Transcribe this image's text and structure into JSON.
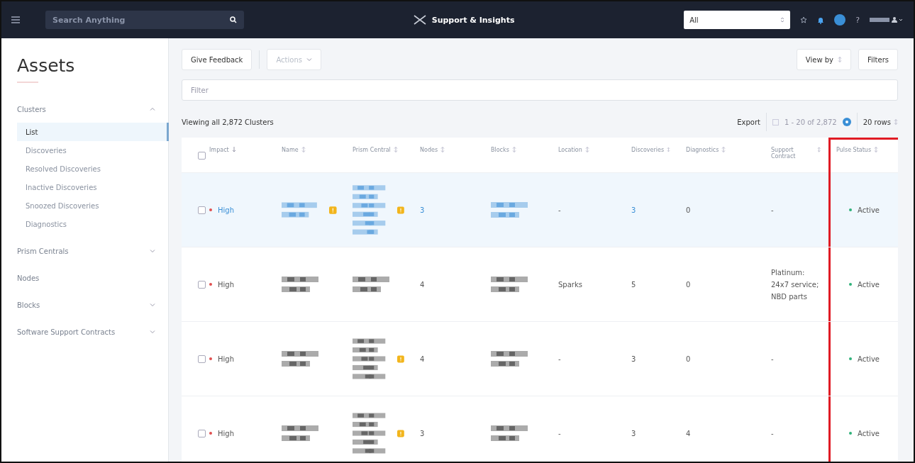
{
  "topbar": {
    "search": {
      "placeholder": "Search Anything"
    },
    "title": "Support & Insights",
    "scope": {
      "value": "All"
    },
    "help": "?"
  },
  "sidebar": {
    "title": "Assets",
    "groups": [
      {
        "label": "Clusters",
        "expanded": true,
        "children": [
          {
            "label": "List",
            "selected": true
          },
          {
            "label": "Discoveries",
            "selected": false
          },
          {
            "label": "Resolved Discoveries",
            "selected": false
          },
          {
            "label": "Inactive Discoveries",
            "selected": false
          },
          {
            "label": "Snoozed Discoveries",
            "selected": false
          },
          {
            "label": "Diagnostics",
            "selected": false
          }
        ]
      },
      {
        "label": "Prism Centrals",
        "expanded": false
      },
      {
        "label": "Nodes"
      },
      {
        "label": "Blocks",
        "expanded": false
      },
      {
        "label": "Software Support Contracts",
        "expanded": false
      }
    ]
  },
  "toolbar": {
    "feedback": "Give Feedback",
    "actions": {
      "label": "Actions",
      "disabled": true
    },
    "view_by": "View by",
    "filters": "Filters"
  },
  "filter": {
    "placeholder": "Filter"
  },
  "summary": "Viewing all 2,872 Clusters",
  "pager": {
    "export": "Export",
    "range": "1 - 20 of 2,872",
    "rows": "20 rows"
  },
  "table": {
    "all_checked": false,
    "columns": [
      {
        "label": "Impact",
        "sorted": true,
        "highlighted": false
      },
      {
        "label": "Name",
        "sorted": false,
        "highlighted": false
      },
      {
        "label": "Prism Central",
        "sorted": false,
        "highlighted": false
      },
      {
        "label": "Nodes",
        "sorted": false,
        "highlighted": false
      },
      {
        "label": "Blocks",
        "sorted": false,
        "highlighted": false
      },
      {
        "label": "Location",
        "sorted": false,
        "highlighted": false
      },
      {
        "label": "Discoveries",
        "sorted": false,
        "highlighted": false
      },
      {
        "label": "Diagnostics",
        "sorted": false,
        "highlighted": false
      },
      {
        "label": "Support Contract",
        "sorted": false,
        "highlighted": false
      },
      {
        "label": "Pulse Status",
        "sorted": false,
        "highlighted": true
      }
    ],
    "rows": [
      {
        "selected": true,
        "checked": false,
        "impact": "High",
        "name_warning": true,
        "prism_warning": true,
        "nodes": "3",
        "location": "-",
        "discoveries": "3",
        "diagnostics": "0",
        "support": "-",
        "status": "Active"
      },
      {
        "selected": false,
        "checked": false,
        "impact": "High",
        "name_warning": false,
        "prism_warning": false,
        "nodes": "4",
        "location": "Sparks",
        "discoveries": "5",
        "diagnostics": "0",
        "support": "Platinum: 24x7 service; NBD parts",
        "status": "Active"
      },
      {
        "selected": false,
        "checked": false,
        "impact": "High",
        "name_warning": false,
        "prism_warning": true,
        "nodes": "4",
        "location": "-",
        "discoveries": "3",
        "diagnostics": "0",
        "support": "-",
        "status": "Active"
      },
      {
        "selected": false,
        "checked": false,
        "impact": "High",
        "name_warning": false,
        "prism_warning": true,
        "nodes": "3",
        "location": "-",
        "discoveries": "3",
        "diagnostics": "4",
        "support": "-",
        "status": "Active"
      }
    ]
  }
}
